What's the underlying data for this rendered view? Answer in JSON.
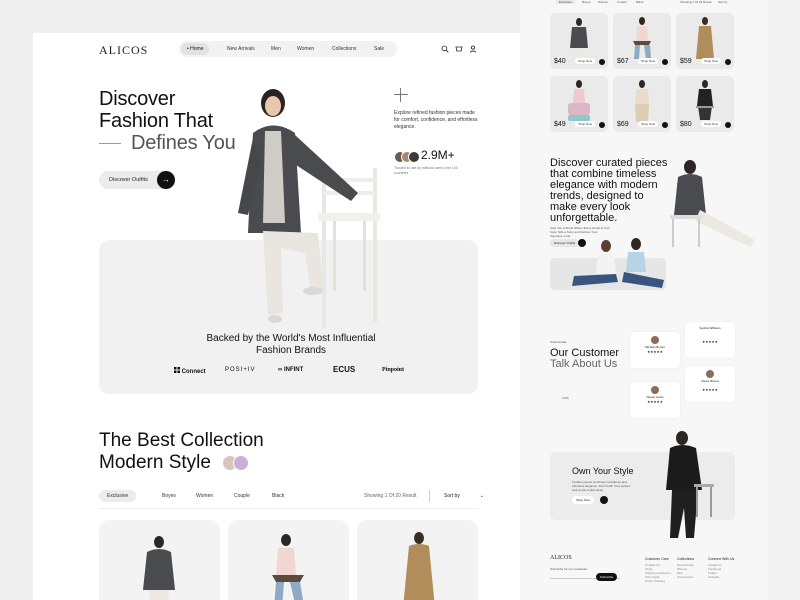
{
  "brand": {
    "logo": "ALICOS"
  },
  "nav": {
    "items": [
      "Home",
      "New Arrivals",
      "Men",
      "Women",
      "Collections",
      "Sale"
    ],
    "icons": [
      "search-icon",
      "cart-icon",
      "user-icon"
    ]
  },
  "hero": {
    "line1": "Discover",
    "line2": "Fashion That",
    "line3": "Defines You",
    "cta": "Discover Outfits",
    "cta_icon": "→",
    "desc": "Explore refined fashion pieces made for comfort, confidence, and effortless elegance.",
    "stat": "2.9M+",
    "stat_sub": "Trusted to use by millions users over 140 countries"
  },
  "brands": {
    "heading_line1": "Backed by the World's Most Influential",
    "heading_line2": "Fashion Brands",
    "logos": [
      "Connect",
      "POSI+IV",
      "INFINT",
      "ECUS",
      "Pinpoint"
    ]
  },
  "collection": {
    "title_line1": "The Best Collection",
    "title_line2": "Modern Style",
    "tabs": [
      "Exclusive",
      "Boyes",
      "Women",
      "Couple",
      "Black"
    ],
    "showing": "Showing 1 Of 20 Result",
    "sort_label": "Sort by"
  },
  "side": {
    "tabs": [
      "Exclusive",
      "Boyes",
      "Women",
      "Couple",
      "Black"
    ],
    "showing": "Showing 1 Of 20 Result",
    "sort_label": "Sort by",
    "products": [
      {
        "price": "$40"
      },
      {
        "price": "$67"
      },
      {
        "price": "$59"
      },
      {
        "price": "$49"
      },
      {
        "price": "$69"
      },
      {
        "price": "$80"
      }
    ],
    "shop_label": "Shop Now",
    "curated_l1": "Discover curated pieces",
    "curated_l2": "that combine timeless",
    "curated_l3": "elegance with modern",
    "curated_l4": "trends, designed to",
    "curated_l5": "make every look",
    "curated_l6": "unforgettable.",
    "curated_desc": "Step Into a World Where Every Detail of Your Style Tells a Story and Defines Your Signature Look",
    "curated_btn": "Discover Outfits",
    "testimonial_tag": "Testimonials",
    "customer_l1": "Our Customer",
    "customer_l2": "Talk About Us",
    "reviews_count": "4.9/5",
    "reviews": [
      {
        "name": "Michael Bryant",
        "stars": "★★★★★"
      },
      {
        "name": "Sophia Williams",
        "stars": "★★★★★"
      },
      {
        "name": "Daniel Lewis",
        "stars": "★★★★★"
      },
      {
        "name": "Alexis Rivera",
        "stars": "★★★★★"
      }
    ],
    "own_title": "Own Your Style",
    "own_desc": "Curates pieces combines confidence and effortless elegance. Don't hold! Your perfect look is just a click away.",
    "own_btn": "Shop Now",
    "footer_logo": "ALICOS",
    "newsletter": "Subscribe for our newsletter",
    "subscribe_btn": "Subscribe",
    "footer_cols": [
      {
        "title": "Customer Care",
        "items": [
          "Contact Us",
          "FAQs",
          "Shipping & Returns",
          "Size Guide",
          "Order Tracking"
        ]
      },
      {
        "title": "Collections",
        "items": [
          "New Arrivals",
          "Women",
          "Men",
          "Accessories"
        ]
      },
      {
        "title": "Connect With Us",
        "items": [
          "Instagram",
          "Facebook",
          "Twitter",
          "LinkedIn"
        ]
      }
    ]
  },
  "colors": {
    "accent": "#111111",
    "panel": "#f1f1f1",
    "background": "#efefef"
  }
}
